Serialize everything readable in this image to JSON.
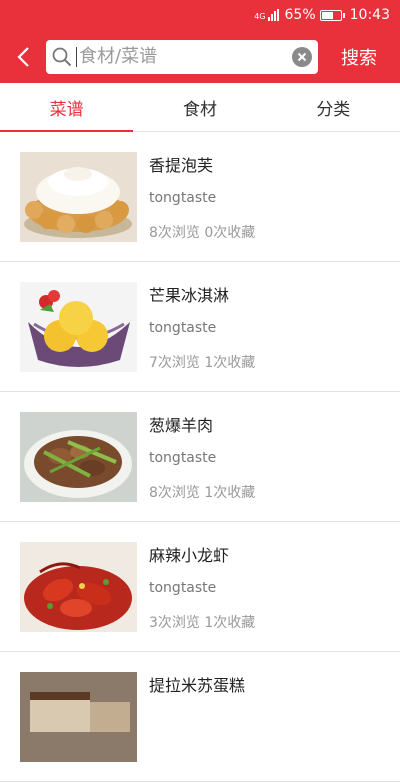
{
  "status": {
    "network": "4G",
    "battery": "65%",
    "battery_level": 0.65,
    "time": "10:43"
  },
  "header": {
    "search_placeholder": "食材/菜谱",
    "search_button": "搜索"
  },
  "tabs": [
    {
      "label": "菜谱",
      "active": true
    },
    {
      "label": "食材",
      "active": false
    },
    {
      "label": "分类",
      "active": false
    }
  ],
  "recipes": [
    {
      "title": "香提泡芙",
      "author": "tongtaste",
      "stats": "8次浏览 0次收藏",
      "image": "cream-puff-tower"
    },
    {
      "title": "芒果冰淇淋",
      "author": "tongtaste",
      "stats": "7次浏览 1次收藏",
      "image": "mango-ice-cream"
    },
    {
      "title": "葱爆羊肉",
      "author": "tongtaste",
      "stats": "8次浏览 1次收藏",
      "image": "scallion-lamb"
    },
    {
      "title": "麻辣小龙虾",
      "author": "tongtaste",
      "stats": "3次浏览 1次收藏",
      "image": "spicy-crayfish"
    },
    {
      "title": "提拉米苏蛋糕",
      "author": "",
      "stats": "",
      "image": "tiramisu-cake"
    }
  ],
  "colors": {
    "accent": "#e8313a"
  }
}
